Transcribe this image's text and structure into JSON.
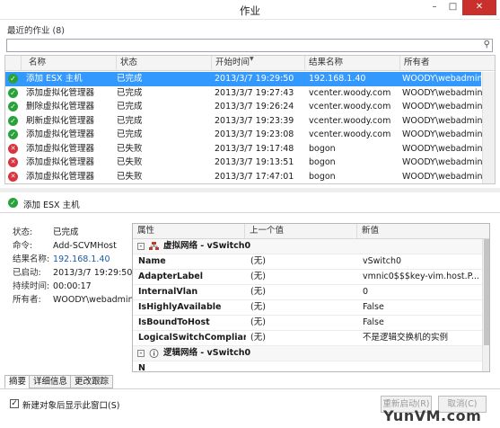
{
  "window": {
    "title": "作业",
    "minimize_label": "–",
    "maximize_label": "□",
    "close_label": "✕"
  },
  "jobs": {
    "section_label": "最近的作业 (8)",
    "search_placeholder": "",
    "columns": [
      "名称",
      "状态",
      "开始时间",
      "结果名称",
      "所有者"
    ],
    "rows": [
      {
        "name": "添加 ESX 主机",
        "status": "已完成",
        "start": "2013/3/7 19:29:50",
        "result": "192.168.1.40",
        "owner": "WOODY\\webadmin",
        "state": "ok"
      },
      {
        "name": "添加虚拟化管理器",
        "status": "已完成",
        "start": "2013/3/7 19:27:43",
        "result": "vcenter.woody.com",
        "owner": "WOODY\\webadmin",
        "state": "ok"
      },
      {
        "name": "删除虚拟化管理器",
        "status": "已完成",
        "start": "2013/3/7 19:26:24",
        "result": "vcenter.woody.com",
        "owner": "WOODY\\webadmin",
        "state": "ok"
      },
      {
        "name": "刷新虚拟化管理器",
        "status": "已完成",
        "start": "2013/3/7 19:23:39",
        "result": "vcenter.woody.com",
        "owner": "WOODY\\webadmin",
        "state": "ok"
      },
      {
        "name": "添加虚拟化管理器",
        "status": "已完成",
        "start": "2013/3/7 19:23:08",
        "result": "vcenter.woody.com",
        "owner": "WOODY\\webadmin",
        "state": "ok"
      },
      {
        "name": "添加虚拟化管理器",
        "status": "已失败",
        "start": "2013/3/7 19:17:48",
        "result": "bogon",
        "owner": "WOODY\\webadmin",
        "state": "fail"
      },
      {
        "name": "添加虚拟化管理器",
        "status": "已失败",
        "start": "2013/3/7 19:13:51",
        "result": "bogon",
        "owner": "WOODY\\webadmin",
        "state": "fail"
      },
      {
        "name": "添加虚拟化管理器",
        "status": "已失败",
        "start": "2013/3/7 17:47:01",
        "result": "bogon",
        "owner": "WOODY\\webadmin",
        "state": "fail"
      }
    ]
  },
  "detail": {
    "title": "添加 ESX 主机",
    "fields": [
      {
        "key": "状态:",
        "value": "已完成"
      },
      {
        "key": "命令:",
        "value": "Add-SCVMHost"
      },
      {
        "key": "结果名称:",
        "value": "192.168.1.40"
      },
      {
        "key": "已启动:",
        "value": "2013/3/7 19:29:50"
      },
      {
        "key": "持续时间:",
        "value": "00:00:17"
      },
      {
        "key": "所有者:",
        "value": "WOODY\\webadmin"
      }
    ],
    "props_columns": [
      "属性",
      "上一个值",
      "新值"
    ],
    "groups": [
      {
        "label": "虚拟网络 - vSwitch0",
        "toggle": "-"
      },
      {
        "label": "逻辑网络 - vSwitch0",
        "toggle": "-"
      }
    ],
    "props": [
      {
        "name": "Name",
        "old": "(无)",
        "new": "vSwitch0"
      },
      {
        "name": "AdapterLabel",
        "old": "(无)",
        "new": "vmnic0$$$key-vim.host.P..."
      },
      {
        "name": "InternalVlan",
        "old": "(无)",
        "new": "0"
      },
      {
        "name": "IsHighlyAvailable",
        "old": "(无)",
        "new": "False"
      },
      {
        "name": "IsBoundToHost",
        "old": "(无)",
        "new": "False"
      },
      {
        "name": "LogicalSwitchComplianc...",
        "old": "(无)",
        "new": "不是逻辑交换机的实例"
      },
      {
        "name": "N",
        "old": "",
        "new": ""
      }
    ],
    "tabs": [
      "摘要",
      "详细信息",
      "更改跟踪"
    ]
  },
  "footer": {
    "checkbox_label": "新建对象后显示此窗口(S)",
    "checkbox_mark": "✓",
    "restart_label": "重新启动(R)",
    "cancel_label": "取消(C)"
  },
  "watermark": "YunVM.com",
  "colors": {
    "selection": "#3399ff",
    "ok": "#27a33a",
    "fail": "#d9343d",
    "close_button": "#c9302c",
    "link": "#1a5aa8"
  }
}
